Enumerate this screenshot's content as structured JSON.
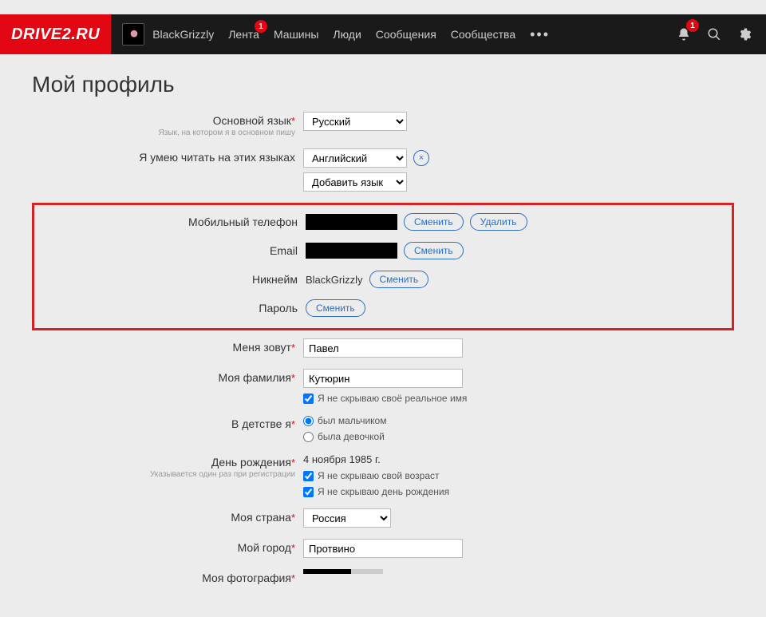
{
  "logo": "DRIVE2.RU",
  "nav": {
    "username": "BlackGrizzly",
    "feed": "Лента",
    "feed_badge": "1",
    "cars": "Машины",
    "people": "Люди",
    "messages": "Сообщения",
    "communities": "Сообщества"
  },
  "notif_badge": "1",
  "title": "Мой профиль",
  "lang": {
    "label": "Основной язык",
    "hint": "Язык, на котором я в основном пишу",
    "value": "Русский"
  },
  "read_langs": {
    "label": "Я умею читать на этих языках",
    "value": "Английский",
    "add": "Добавить язык"
  },
  "phone": {
    "label": "Мобильный телефон"
  },
  "email": {
    "label": "Email"
  },
  "nickname": {
    "label": "Никнейм",
    "value": "BlackGrizzly"
  },
  "password": {
    "label": "Пароль"
  },
  "btn": {
    "change": "Сменить",
    "delete": "Удалить"
  },
  "name": {
    "label": "Меня зовут",
    "value": "Павел"
  },
  "surname": {
    "label": "Моя фамилия",
    "value": "Кутюрин",
    "chk": "Я не скрываю своё реальное имя"
  },
  "child": {
    "label": "В детстве я",
    "boy": "был мальчиком",
    "girl": "была девочкой"
  },
  "bday": {
    "label": "День рождения",
    "hint": "Указывается один раз при регистрации",
    "value": "4 ноября 1985 г.",
    "chk1": "Я не скрываю свой возраст",
    "chk2": "Я не скрываю день рождения"
  },
  "country": {
    "label": "Моя страна",
    "value": "Россия"
  },
  "city": {
    "label": "Мой город",
    "value": "Протвино"
  },
  "photo": {
    "label": "Моя фотография"
  }
}
